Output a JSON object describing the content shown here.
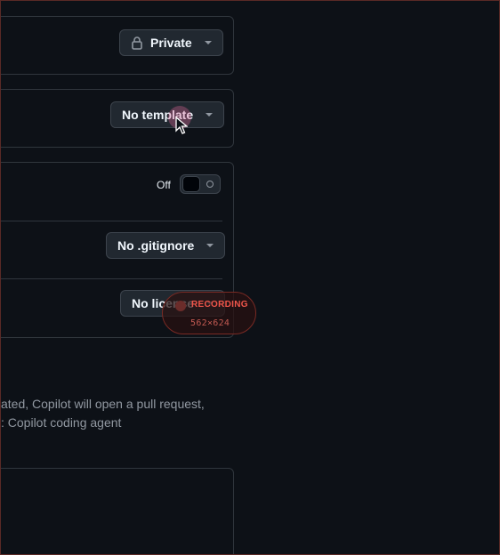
{
  "visibility": {
    "label": "Private",
    "icon": "lock-icon"
  },
  "template": {
    "label": "No template"
  },
  "readme_toggle": {
    "state_label": "Off"
  },
  "gitignore": {
    "label": "No .gitignore"
  },
  "license": {
    "label": "No license"
  },
  "copilot_text": {
    "line1": "ated, Copilot will open a pull request,",
    "line2": ": Copilot coding agent"
  },
  "recording_indicator": {
    "title": "RECORDING",
    "size": "562×624"
  }
}
